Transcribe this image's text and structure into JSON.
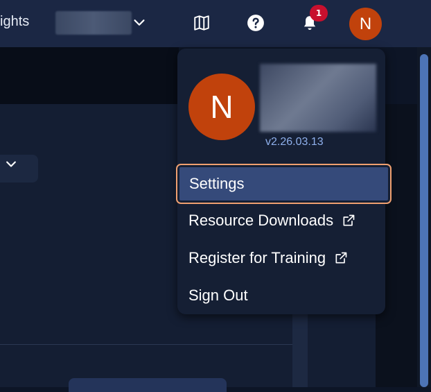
{
  "header": {
    "nav_label": "ights",
    "notifications_count": "1",
    "avatar_initial": "N"
  },
  "user_menu": {
    "avatar_initial": "N",
    "version": "v2.26.03.13",
    "items": [
      {
        "label": "Settings",
        "external": false,
        "highlighted": true
      },
      {
        "label": "Resource Downloads",
        "external": true
      },
      {
        "label": "Register for Training",
        "external": true
      },
      {
        "label": "Sign Out",
        "external": false
      }
    ]
  },
  "icons": [
    "map-icon",
    "help-icon",
    "bell-icon",
    "chevron-down-icon",
    "external-link-icon"
  ],
  "colors": {
    "topbar": "#1b2744",
    "menu_bg": "#151f34",
    "highlight": "#354a7a",
    "focus_ring": "#f0a070",
    "avatar": "#c1420c",
    "badge": "#c8102e",
    "version_text": "#8fb0ec"
  }
}
